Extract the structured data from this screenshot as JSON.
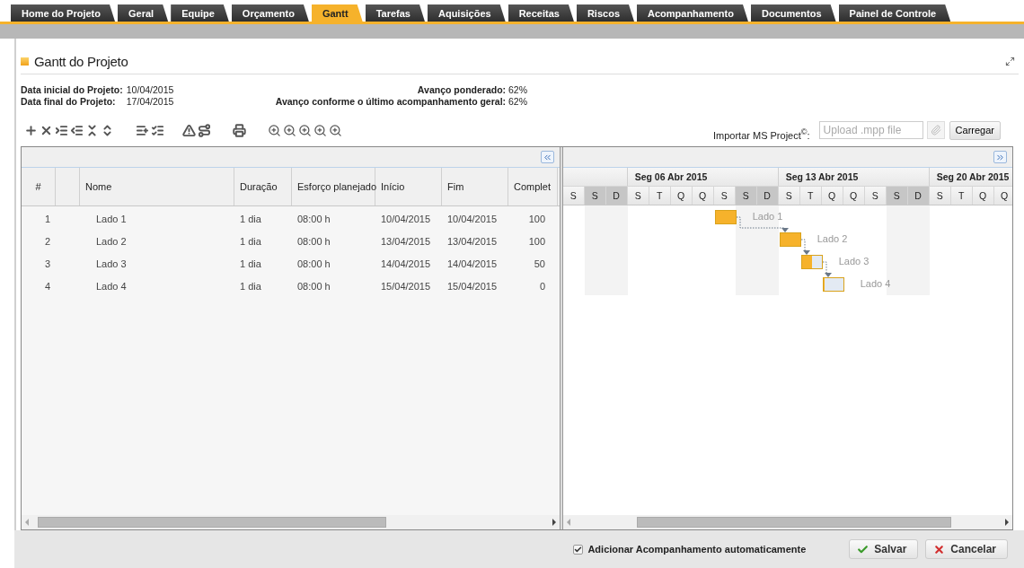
{
  "tabs": [
    {
      "label": "Home do Projeto",
      "selected": false
    },
    {
      "label": "Geral",
      "selected": false
    },
    {
      "label": "Equipe",
      "selected": false
    },
    {
      "label": "Orçamento",
      "selected": false
    },
    {
      "label": "Gantt",
      "selected": true
    },
    {
      "label": "Tarefas",
      "selected": false
    },
    {
      "label": "Aquisições",
      "selected": false
    },
    {
      "label": "Receitas",
      "selected": false
    },
    {
      "label": "Riscos",
      "selected": false
    },
    {
      "label": "Acompanhamento",
      "selected": false
    },
    {
      "label": "Documentos",
      "selected": false
    },
    {
      "label": "Painel de Controle",
      "selected": false
    }
  ],
  "page_title": "Gantt do Projeto",
  "info": {
    "start_label": "Data inicial do Projeto:",
    "start_value": "10/04/2015",
    "end_label": "Data final do Projeto:",
    "end_value": "17/04/2015",
    "weighted_label": "Avanço ponderado:",
    "weighted_value": "62%",
    "tracking_label": "Avanço conforme o último acompanhamento geral:",
    "tracking_value": "62%"
  },
  "import": {
    "label": "Importar MS Project$^{©}$:",
    "placeholder": "Upload .mpp file",
    "button": "Carregar"
  },
  "grid": {
    "columns": [
      "#",
      "Nome",
      "Duração",
      "Esforço planejado",
      "Início",
      "Fim",
      "Complet"
    ],
    "rows": [
      {
        "num": "1",
        "name": "Lado 1",
        "duration": "1 dia",
        "effort": "08:00 h",
        "start": "10/04/2015",
        "end": "10/04/2015",
        "complete": "100"
      },
      {
        "num": "2",
        "name": "Lado 2",
        "duration": "1 dia",
        "effort": "08:00 h",
        "start": "13/04/2015",
        "end": "13/04/2015",
        "complete": "100"
      },
      {
        "num": "3",
        "name": "Lado 3",
        "duration": "1 dia",
        "effort": "08:00 h",
        "start": "14/04/2015",
        "end": "14/04/2015",
        "complete": "50"
      },
      {
        "num": "4",
        "name": "Lado 4",
        "duration": "1 dia",
        "effort": "08:00 h",
        "start": "15/04/2015",
        "end": "15/04/2015",
        "complete": "0"
      }
    ]
  },
  "gantt": {
    "weeks": [
      {
        "days": [
          {
            "letter": "S",
            "weekend": false
          },
          {
            "letter": "S",
            "weekend": true
          },
          {
            "letter": "D",
            "weekend": true
          }
        ]
      },
      {
        "label": "Seg 06 Abr 2015",
        "days": [
          {
            "letter": "S",
            "weekend": false
          },
          {
            "letter": "T",
            "weekend": false
          },
          {
            "letter": "Q",
            "weekend": false
          },
          {
            "letter": "Q",
            "weekend": false
          },
          {
            "letter": "S",
            "weekend": false
          },
          {
            "letter": "S",
            "weekend": true
          },
          {
            "letter": "D",
            "weekend": true
          }
        ]
      },
      {
        "label": "Seg 13 Abr 2015",
        "days": [
          {
            "letter": "S",
            "weekend": false
          },
          {
            "letter": "T",
            "weekend": false
          },
          {
            "letter": "Q",
            "weekend": false
          },
          {
            "letter": "Q",
            "weekend": false
          },
          {
            "letter": "S",
            "weekend": false
          },
          {
            "letter": "S",
            "weekend": true
          },
          {
            "letter": "D",
            "weekend": true
          }
        ]
      },
      {
        "label": "Seg 20 Abr 2015",
        "days": [
          {
            "letter": "S",
            "weekend": false
          },
          {
            "letter": "T",
            "weekend": false
          },
          {
            "letter": "Q",
            "weekend": false
          },
          {
            "letter": "Q",
            "weekend": false
          }
        ]
      }
    ],
    "bars": [
      {
        "label": "Lado 1",
        "level": 1
      },
      {
        "label": "Lado 2",
        "level": 1,
        "linked_from_previous": true
      },
      {
        "label": "Lado 3",
        "level": 0.5,
        "linked_from_previous": true
      },
      {
        "label": "Lado 4",
        "level": 0,
        "linked_from_previous": true
      }
    ]
  },
  "footer": {
    "auto_tracking_label": "Adicionar Acompanhamento automaticamente",
    "auto_tracking_checked": true,
    "save": "Salvar",
    "cancel": "Cancelar"
  }
}
